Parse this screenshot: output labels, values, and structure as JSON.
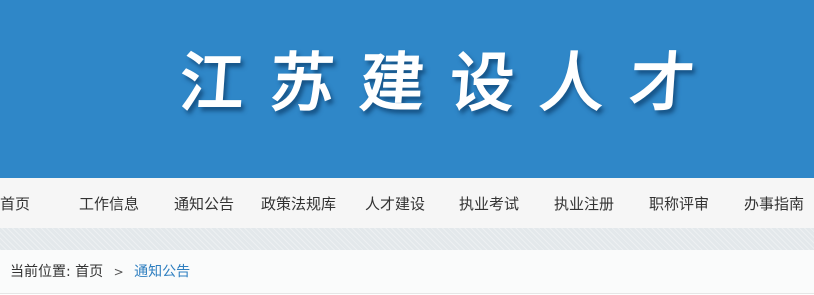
{
  "header": {
    "logo_chars": [
      "江",
      "苏",
      "建",
      "设",
      "人",
      "才"
    ]
  },
  "nav": {
    "items": [
      {
        "label": "首页"
      },
      {
        "label": "工作信息"
      },
      {
        "label": "通知公告"
      },
      {
        "label": "政策法规库"
      },
      {
        "label": "人才建设"
      },
      {
        "label": "执业考试"
      },
      {
        "label": "执业注册"
      },
      {
        "label": "职称评审"
      },
      {
        "label": "办事指南"
      }
    ]
  },
  "breadcrumb": {
    "prefix": "当前位置:",
    "home": "首页",
    "separator": ">",
    "current": "通知公告"
  },
  "colors": {
    "banner": "#2f87c8",
    "nav_background": "#f6f6f6",
    "breadcrumb_active": "#2f7fc0"
  }
}
